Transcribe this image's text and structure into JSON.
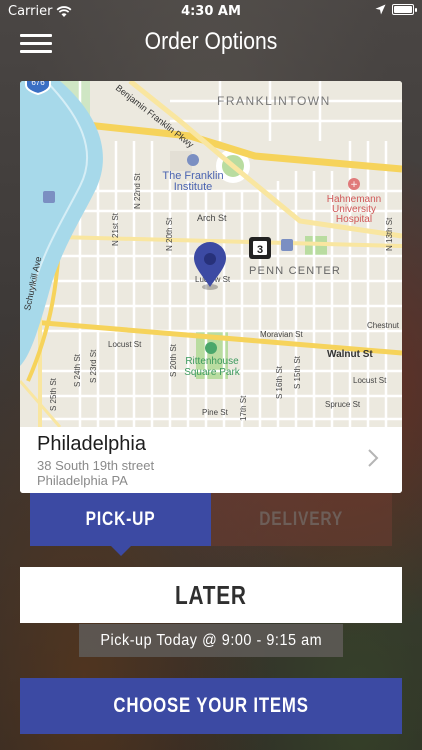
{
  "status_bar": {
    "carrier": "Carrier",
    "time": "4:30 AM",
    "battery_level": 1.0
  },
  "nav": {
    "title": "Order Options",
    "menu_icon": "hamburger-menu-icon"
  },
  "map": {
    "labels": {
      "franklintown": "FRANKLINTOWN",
      "franklin_pkwy": "Benjamin Franklin Pkwy",
      "franklin_institute_1": "The Franklin",
      "franklin_institute_2": "Institute",
      "hahnemann_1": "Hahnemann",
      "hahnemann_2": "University",
      "hahnemann_3": "Hospital",
      "arch_st": "Arch St",
      "n22nd": "N 22nd St",
      "n21st": "N 21st St",
      "n20th": "N 20th St",
      "n13th": "N 13th St",
      "schuylkill": "Schuylkill Ave",
      "penn_center": "PENN CENTER",
      "ludlow": "Ludlow St",
      "moravian": "Moravian St",
      "chestnut": "Chestnut",
      "walnut": "Walnut St",
      "locust_left": "Locust St",
      "locust_right": "Locust St",
      "rittenhouse_1": "Rittenhouse",
      "rittenhouse_2": "Square Park",
      "s24th": "S 24th St",
      "s23rd": "S 23rd St",
      "s25th": "S 25th St",
      "s20th": "S 20th St",
      "s16th": "S 16th St",
      "s15th": "S 15th St",
      "s17th": "17th St",
      "pine": "Pine St",
      "spruce": "Spruce St",
      "highway": "676",
      "station": "3"
    },
    "colors": {
      "water": "#a7d9ea",
      "park": "#b9dca0",
      "major_road": "#f6d35b",
      "pin": "#3c4aa3"
    }
  },
  "location": {
    "name": "Philadelphia",
    "address": "38 South 19th street",
    "city_line": "Philadelphia  PA"
  },
  "tabs": {
    "pickup": "PICK-UP",
    "delivery": "DELIVERY",
    "selected": "pickup"
  },
  "later": {
    "label": "LATER",
    "pickup_time": "Pick-up Today @ 9:00 - 9:15 am"
  },
  "choose_button": "CHOOSE YOUR ITEMS",
  "colors": {
    "accent": "#3c4aa3"
  }
}
